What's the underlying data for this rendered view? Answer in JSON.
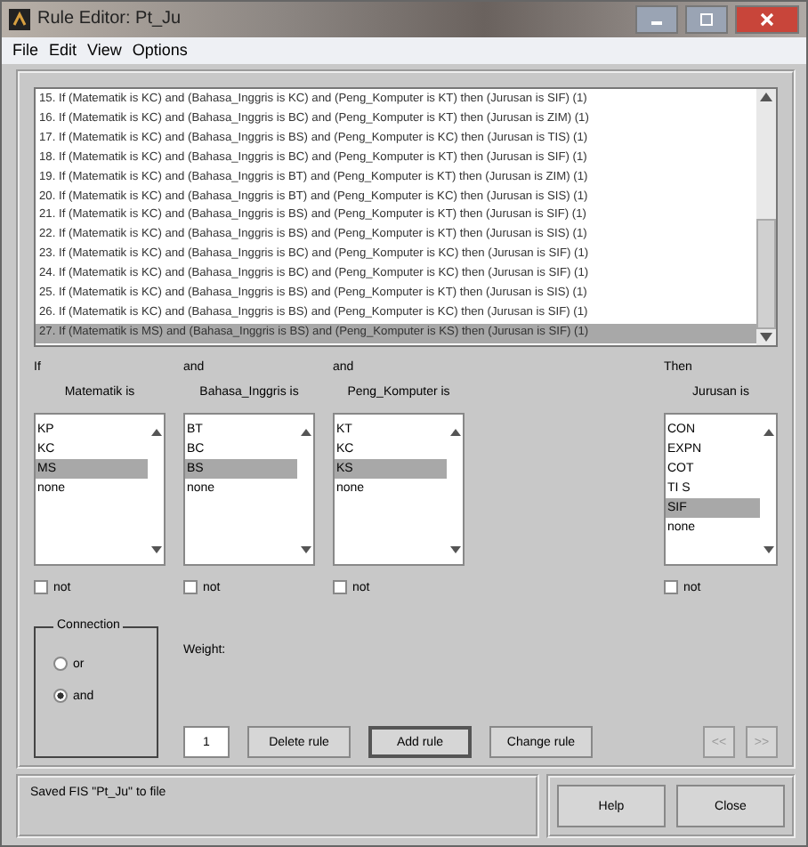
{
  "window": {
    "title": "Rule Editor: Pt_Ju"
  },
  "menu": [
    "File",
    "Edit",
    "View",
    "Options"
  ],
  "rules": [
    {
      "text": "15. If (Matematik is KC) and (Bahasa_Inggris is KC) and (Peng_Komputer is KT) then (Jurusan is SIF) (1)",
      "selected": false
    },
    {
      "text": "16. If (Matematik is KC) and (Bahasa_Inggris is BC) and (Peng_Komputer is KT) then (Jurusan is ZIM) (1)",
      "selected": false
    },
    {
      "text": "17. If (Matematik is KC) and (Bahasa_Inggris is BS) and (Peng_Komputer is KC) then (Jurusan is TIS) (1)",
      "selected": false
    },
    {
      "text": "18. If (Matematik is KC) and (Bahasa_Inggris is BC) and (Peng_Komputer is KT) then (Jurusan is SIF) (1)",
      "selected": false
    },
    {
      "text": "19. If (Matematik is KC) and (Bahasa_Inggris is BT) and (Peng_Komputer is KT) then (Jurusan is ZIM) (1)",
      "selected": false
    },
    {
      "text": "20. If (Matematik is KC) and (Bahasa_Inggris is BT) and (Peng_Komputer is KC) then (Jurusan is SIS) (1)",
      "selected": false
    },
    {
      "text": "21. If (Matematik is KC) and (Bahasa_Inggris is BS) and (Peng_Komputer is KT) then (Jurusan is SIF) (1)",
      "selected": false
    },
    {
      "text": "22. If (Matematik is KC) and (Bahasa_Inggris is BS) and (Peng_Komputer is KT) then (Jurusan is SIS) (1)",
      "selected": false
    },
    {
      "text": "23. If (Matematik is KC) and (Bahasa_Inggris is BC) and (Peng_Komputer is KC) then (Jurusan is SIF) (1)",
      "selected": false
    },
    {
      "text": "24. If (Matematik is KC) and (Bahasa_Inggris is BC) and (Peng_Komputer is KC) then (Jurusan is SIF) (1)",
      "selected": false
    },
    {
      "text": "25. If (Matematik is KC) and (Bahasa_Inggris is BS) and (Peng_Komputer is KT) then (Jurusan is SIS) (1)",
      "selected": false
    },
    {
      "text": "26. If (Matematik is KC) and (Bahasa_Inggris is BS) and (Peng_Komputer is KC) then (Jurusan is SIF) (1)",
      "selected": false
    },
    {
      "text": "27. If (Matematik is MS) and (Bahasa_Inggris is BS) and (Peng_Komputer is KS) then (Jurusan is SIF) (1)",
      "selected": true
    }
  ],
  "inputs": [
    {
      "connector": "If",
      "label": "Matematik is",
      "not_label": "not",
      "not": false,
      "options": [
        {
          "label": "KP",
          "selected": false
        },
        {
          "label": "KC",
          "selected": false
        },
        {
          "label": "MS",
          "selected": true
        },
        {
          "label": "none",
          "selected": false
        }
      ]
    },
    {
      "connector": "and",
      "label": "Bahasa_Inggris is",
      "not_label": "not",
      "not": false,
      "options": [
        {
          "label": "BT",
          "selected": false
        },
        {
          "label": "BC",
          "selected": false
        },
        {
          "label": "BS",
          "selected": true
        },
        {
          "label": "none",
          "selected": false
        }
      ]
    },
    {
      "connector": "and",
      "label": "Peng_Komputer is",
      "not_label": "not",
      "not": false,
      "options": [
        {
          "label": "KT",
          "selected": false
        },
        {
          "label": "KC",
          "selected": false
        },
        {
          "label": "KS",
          "selected": true
        },
        {
          "label": "none",
          "selected": false
        }
      ]
    }
  ],
  "output": {
    "connector": "Then",
    "label": "Jurusan is",
    "not_label": "not",
    "not": false,
    "options": [
      {
        "label": "CON",
        "selected": false
      },
      {
        "label": "EXPN",
        "selected": false
      },
      {
        "label": "COT",
        "selected": false
      },
      {
        "label": "TI S",
        "selected": false
      },
      {
        "label": "SIF",
        "selected": true
      },
      {
        "label": "none",
        "selected": false
      }
    ]
  },
  "connection": {
    "label": "Connection",
    "options": [
      {
        "label": "or",
        "selected": false
      },
      {
        "label": "and",
        "selected": true
      }
    ]
  },
  "weight": {
    "label": "Weight:",
    "value": "1"
  },
  "rule_buttons": [
    "Delete rule",
    "Add rule",
    "Change rule"
  ],
  "nav_buttons": [
    "<<",
    ">>"
  ],
  "status": "Saved FIS \"Pt_Ju\" to file",
  "footer_buttons": [
    "Help",
    "Close"
  ]
}
